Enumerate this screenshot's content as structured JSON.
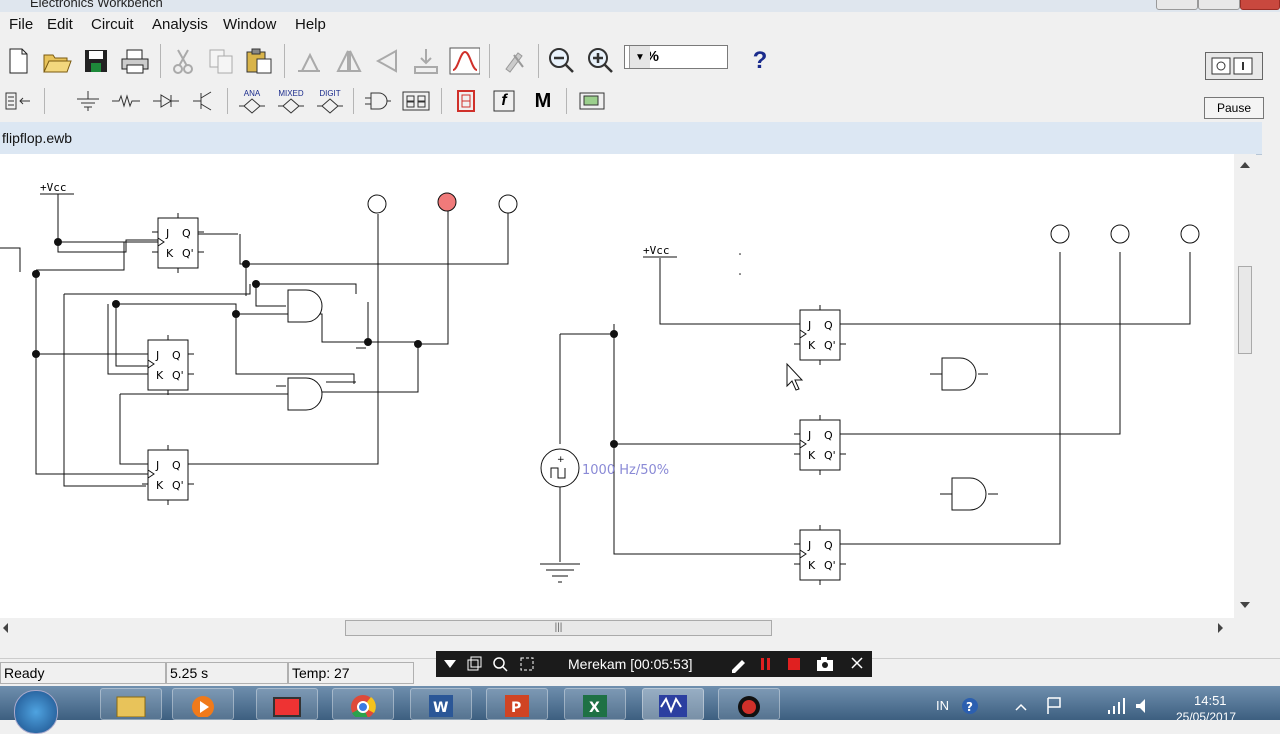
{
  "window": {
    "title": "Electronics Workbench"
  },
  "menu": [
    "File",
    "Edit",
    "Circuit",
    "Analysis",
    "Window",
    "Help"
  ],
  "toolbar": {
    "zoom_value": "80%",
    "help_label": "?",
    "pause_label": "Pause"
  },
  "parts_bin": {
    "analog_label": "ANA",
    "mixed_label": "MIXED",
    "digital_label": "DIGIT",
    "misc_label": "M",
    "func_label": "f"
  },
  "document": {
    "title": "flipflop.ewb"
  },
  "circuit": {
    "vcc_label": "+Vcc",
    "ff_j": "J",
    "ff_k": "K",
    "ff_q": "Q",
    "ff_qn": "Q'",
    "clock_label": "1000 Hz/50%",
    "indicator_colors": {
      "off": "#ffffff",
      "on": "#f07a7a"
    }
  },
  "status": {
    "state": "Ready",
    "time": "5.25 s",
    "temp": "Temp: 27"
  },
  "recorder": {
    "label": "Merekam [00:05:53]"
  },
  "taskbar": {
    "lang": "IN",
    "clock": "14:51",
    "date": "25/05/2017"
  }
}
